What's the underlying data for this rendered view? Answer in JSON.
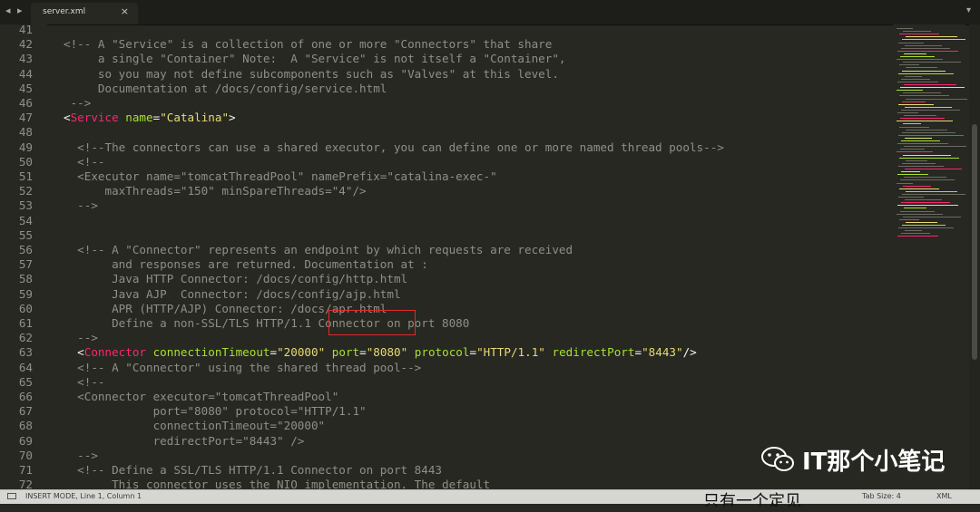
{
  "tab": {
    "title": "server.xml",
    "close": "×",
    "nav": "◂ ▸",
    "dropdown": "▾"
  },
  "lines": [
    {
      "n": "41",
      "t": []
    },
    {
      "n": "42",
      "t": [
        [
          "c",
          "<!-- A \"Service\" is a collection of one or more \"Connectors\" that share"
        ]
      ]
    },
    {
      "n": "43",
      "t": [
        [
          "c",
          "     a single \"Container\" Note:  A \"Service\" is not itself a \"Container\","
        ]
      ]
    },
    {
      "n": "44",
      "t": [
        [
          "c",
          "     so you may not define subcomponents such as \"Valves\" at this level."
        ]
      ]
    },
    {
      "n": "45",
      "t": [
        [
          "c",
          "     Documentation at /docs/config/service.html"
        ]
      ]
    },
    {
      "n": "46",
      "t": [
        [
          "c",
          " -->"
        ]
      ]
    },
    {
      "n": "47",
      "t": [
        [
          "tx",
          "<"
        ],
        [
          "tg",
          "Service"
        ],
        [
          "tx",
          " "
        ],
        [
          "at",
          "name"
        ],
        [
          "tx",
          "="
        ],
        [
          "st",
          "\"Catalina\""
        ],
        [
          "tx",
          ">"
        ]
      ]
    },
    {
      "n": "48",
      "t": []
    },
    {
      "n": "49",
      "t": [
        [
          "c",
          "  <!--The connectors can use a shared executor, you can define one or more named thread pools-->"
        ]
      ]
    },
    {
      "n": "50",
      "t": [
        [
          "c",
          "  <!--"
        ]
      ]
    },
    {
      "n": "51",
      "t": [
        [
          "c",
          "  <Executor name=\"tomcatThreadPool\" namePrefix=\"catalina-exec-\""
        ]
      ]
    },
    {
      "n": "52",
      "t": [
        [
          "c",
          "      maxThreads=\"150\" minSpareThreads=\"4\"/>"
        ]
      ]
    },
    {
      "n": "53",
      "t": [
        [
          "c",
          "  -->"
        ]
      ]
    },
    {
      "n": "54",
      "t": []
    },
    {
      "n": "55",
      "t": []
    },
    {
      "n": "56",
      "t": [
        [
          "c",
          "  <!-- A \"Connector\" represents an endpoint by which requests are received"
        ]
      ]
    },
    {
      "n": "57",
      "t": [
        [
          "c",
          "       and responses are returned. Documentation at :"
        ]
      ]
    },
    {
      "n": "58",
      "t": [
        [
          "c",
          "       Java HTTP Connector: /docs/config/http.html"
        ]
      ]
    },
    {
      "n": "59",
      "t": [
        [
          "c",
          "       Java AJP  Connector: /docs/config/ajp.html"
        ]
      ]
    },
    {
      "n": "60",
      "t": [
        [
          "c",
          "       APR (HTTP/AJP) Connector: /docs/apr.html"
        ]
      ]
    },
    {
      "n": "61",
      "t": [
        [
          "c",
          "       Define a non-SSL/TLS HTTP/1.1 Connector on port 8080"
        ]
      ]
    },
    {
      "n": "62",
      "t": [
        [
          "c",
          "  -->"
        ]
      ]
    },
    {
      "n": "63",
      "t": [
        [
          "tx",
          "  <"
        ],
        [
          "tg",
          "Connector"
        ],
        [
          "tx",
          " "
        ],
        [
          "at",
          "connectionTimeout"
        ],
        [
          "tx",
          "="
        ],
        [
          "st",
          "\"20000\""
        ],
        [
          "tx",
          " "
        ],
        [
          "at",
          "port"
        ],
        [
          "tx",
          "="
        ],
        [
          "st",
          "\"8080\""
        ],
        [
          "tx",
          " "
        ],
        [
          "at",
          "protocol"
        ],
        [
          "tx",
          "="
        ],
        [
          "st",
          "\"HTTP/1.1\""
        ],
        [
          "tx",
          " "
        ],
        [
          "at",
          "redirectPort"
        ],
        [
          "tx",
          "="
        ],
        [
          "st",
          "\"8443\""
        ],
        [
          "tx",
          "/>"
        ]
      ]
    },
    {
      "n": "64",
      "t": [
        [
          "c",
          "  <!-- A \"Connector\" using the shared thread pool-->"
        ]
      ]
    },
    {
      "n": "65",
      "t": [
        [
          "c",
          "  <!--"
        ]
      ]
    },
    {
      "n": "66",
      "t": [
        [
          "c",
          "  <Connector executor=\"tomcatThreadPool\""
        ]
      ]
    },
    {
      "n": "67",
      "t": [
        [
          "c",
          "             port=\"8080\" protocol=\"HTTP/1.1\""
        ]
      ]
    },
    {
      "n": "68",
      "t": [
        [
          "c",
          "             connectionTimeout=\"20000\""
        ]
      ]
    },
    {
      "n": "69",
      "t": [
        [
          "c",
          "             redirectPort=\"8443\" />"
        ]
      ]
    },
    {
      "n": "70",
      "t": [
        [
          "c",
          "  -->"
        ]
      ]
    },
    {
      "n": "71",
      "t": [
        [
          "c",
          "  <!-- Define a SSL/TLS HTTP/1.1 Connector on port 8443"
        ]
      ]
    },
    {
      "n": "72",
      "t": [
        [
          "c",
          "       This connector uses the NIO implementation. The default"
        ]
      ]
    }
  ],
  "status": {
    "mode": "INSERT MODE, Line 1, Column 1",
    "tab_size": "Tab Size: 4",
    "syntax": "XML",
    "cut_text": "只有一个定见"
  },
  "watermark": {
    "text": "IT那个小笔记",
    "logo": "wechat-logo"
  },
  "colors": {
    "background": "#272822",
    "comment": "#8f8f86",
    "tag": "#f92672",
    "attribute": "#a6e22e",
    "string": "#e6db74",
    "highlight_box": "#e02b2b"
  }
}
